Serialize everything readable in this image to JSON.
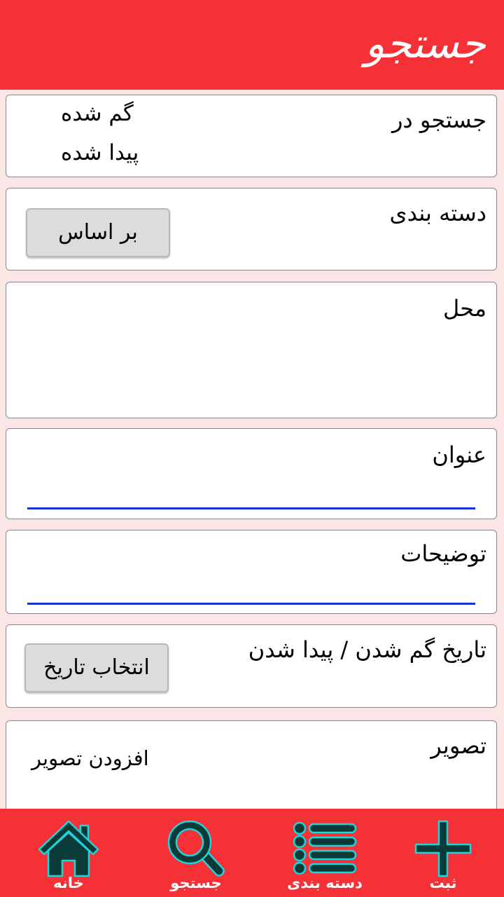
{
  "header": {
    "title": "جستجو"
  },
  "search_in": {
    "label": "جستجو در",
    "options": [
      "گم شده",
      "پیدا شده"
    ]
  },
  "category": {
    "label": "دسته بندی",
    "button_label": "بر اساس"
  },
  "location": {
    "label": "محل"
  },
  "title_field": {
    "label": "عنوان",
    "value": ""
  },
  "description_field": {
    "label": "توضیحات",
    "value": ""
  },
  "date": {
    "label": "تاریخ گم شدن / پیدا شدن",
    "button_label": "انتخاب تاریخ"
  },
  "image": {
    "label": "تصویر",
    "add_label": "افزودن تصویر"
  },
  "bottom_nav": {
    "items": [
      {
        "label": "ثبت",
        "icon": "plus-icon"
      },
      {
        "label": "دسته بندی",
        "icon": "list-icon"
      },
      {
        "label": "جستجو",
        "icon": "search-icon"
      },
      {
        "label": "خانه",
        "icon": "home-icon"
      }
    ]
  },
  "colors": {
    "primary": "#f53137",
    "icon_fill": "#0b3b38",
    "icon_outline": "#20d3d8",
    "input_underline": "#1634d6"
  }
}
